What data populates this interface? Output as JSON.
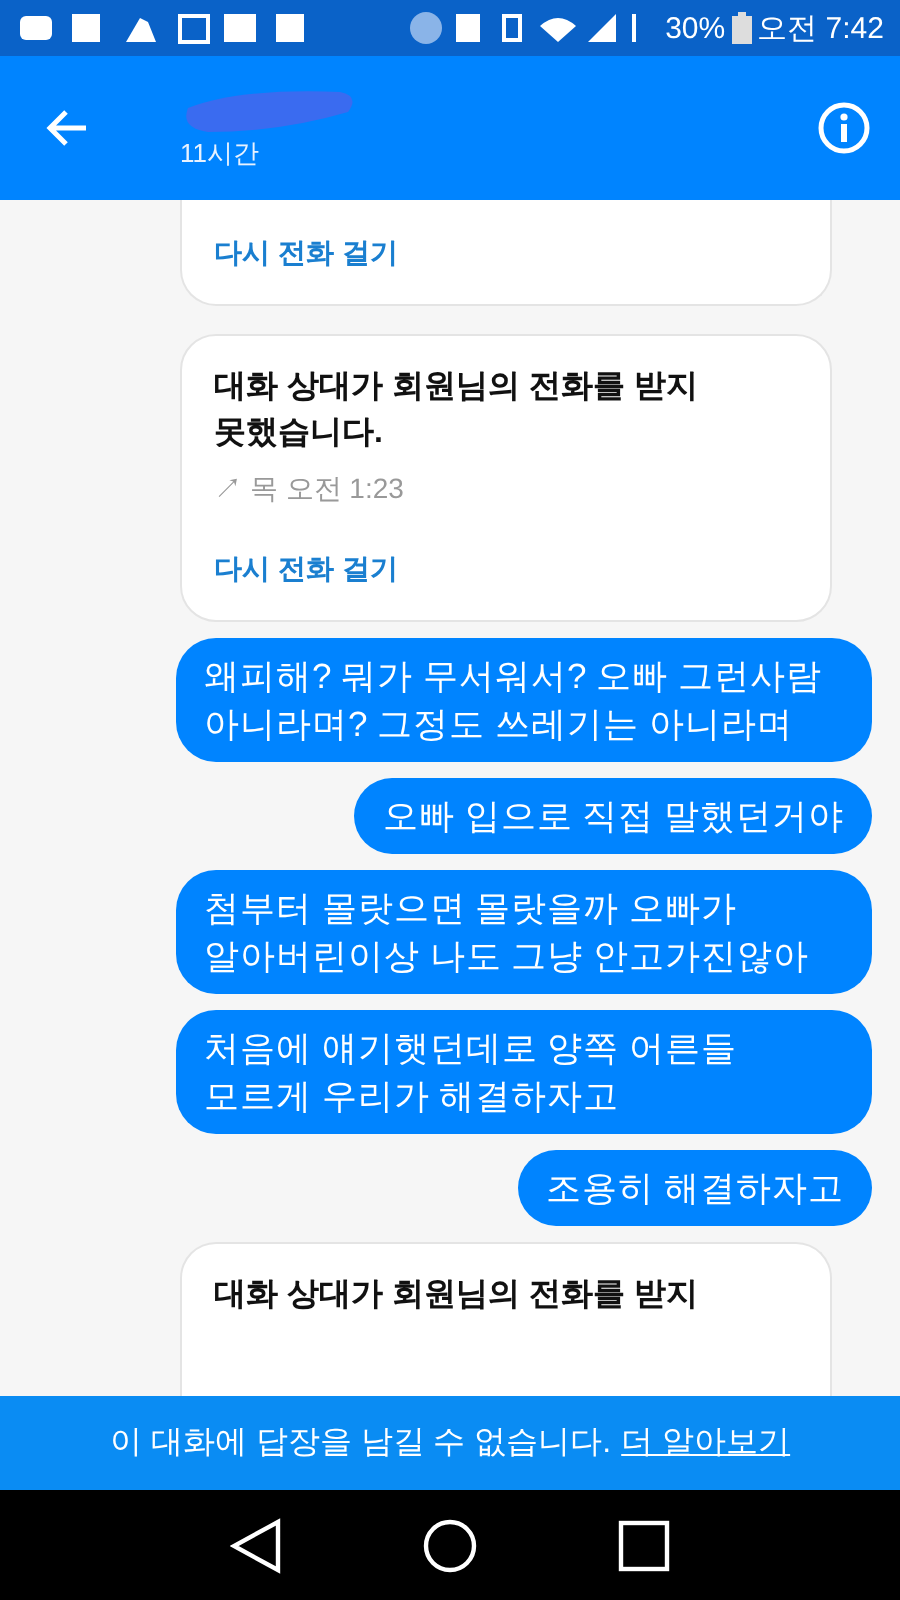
{
  "status_bar": {
    "battery": "30%",
    "time": "오전 7:42"
  },
  "header": {
    "subtitle": "11시간"
  },
  "messages": [
    {
      "kind": "call",
      "clipped_top": true,
      "action": "다시 전화 걸기"
    },
    {
      "kind": "call",
      "title": "대화 상대가 회원님의 전화를 받지 못했습니다.",
      "meta": "↗ 목 오전 1:23",
      "action": "다시 전화 걸기"
    },
    {
      "kind": "text",
      "text": "왜피해? 뭐가 무서워서? 오빠 그런사람 아니라며? 그정도 쓰레기는 아니라며"
    },
    {
      "kind": "text",
      "text": "오빠 입으로 직접 말했던거야"
    },
    {
      "kind": "text",
      "text": "첨부터 몰랏으면 몰랏을까 오빠가 알아버린이상 나도 그냥 안고가진않아"
    },
    {
      "kind": "text",
      "text": "처음에 얘기햇던데로 양쪽 어른들 모르게 우리가 해결하자고"
    },
    {
      "kind": "text",
      "text": "조용히 해결하자고"
    },
    {
      "kind": "call",
      "clipped_bottom": true,
      "title": "대화 상대가 회원님의 전화를 받지"
    }
  ],
  "banner": {
    "text": "이 대화에 답장을 남길 수 없습니다.",
    "link": "더 알아보기"
  }
}
